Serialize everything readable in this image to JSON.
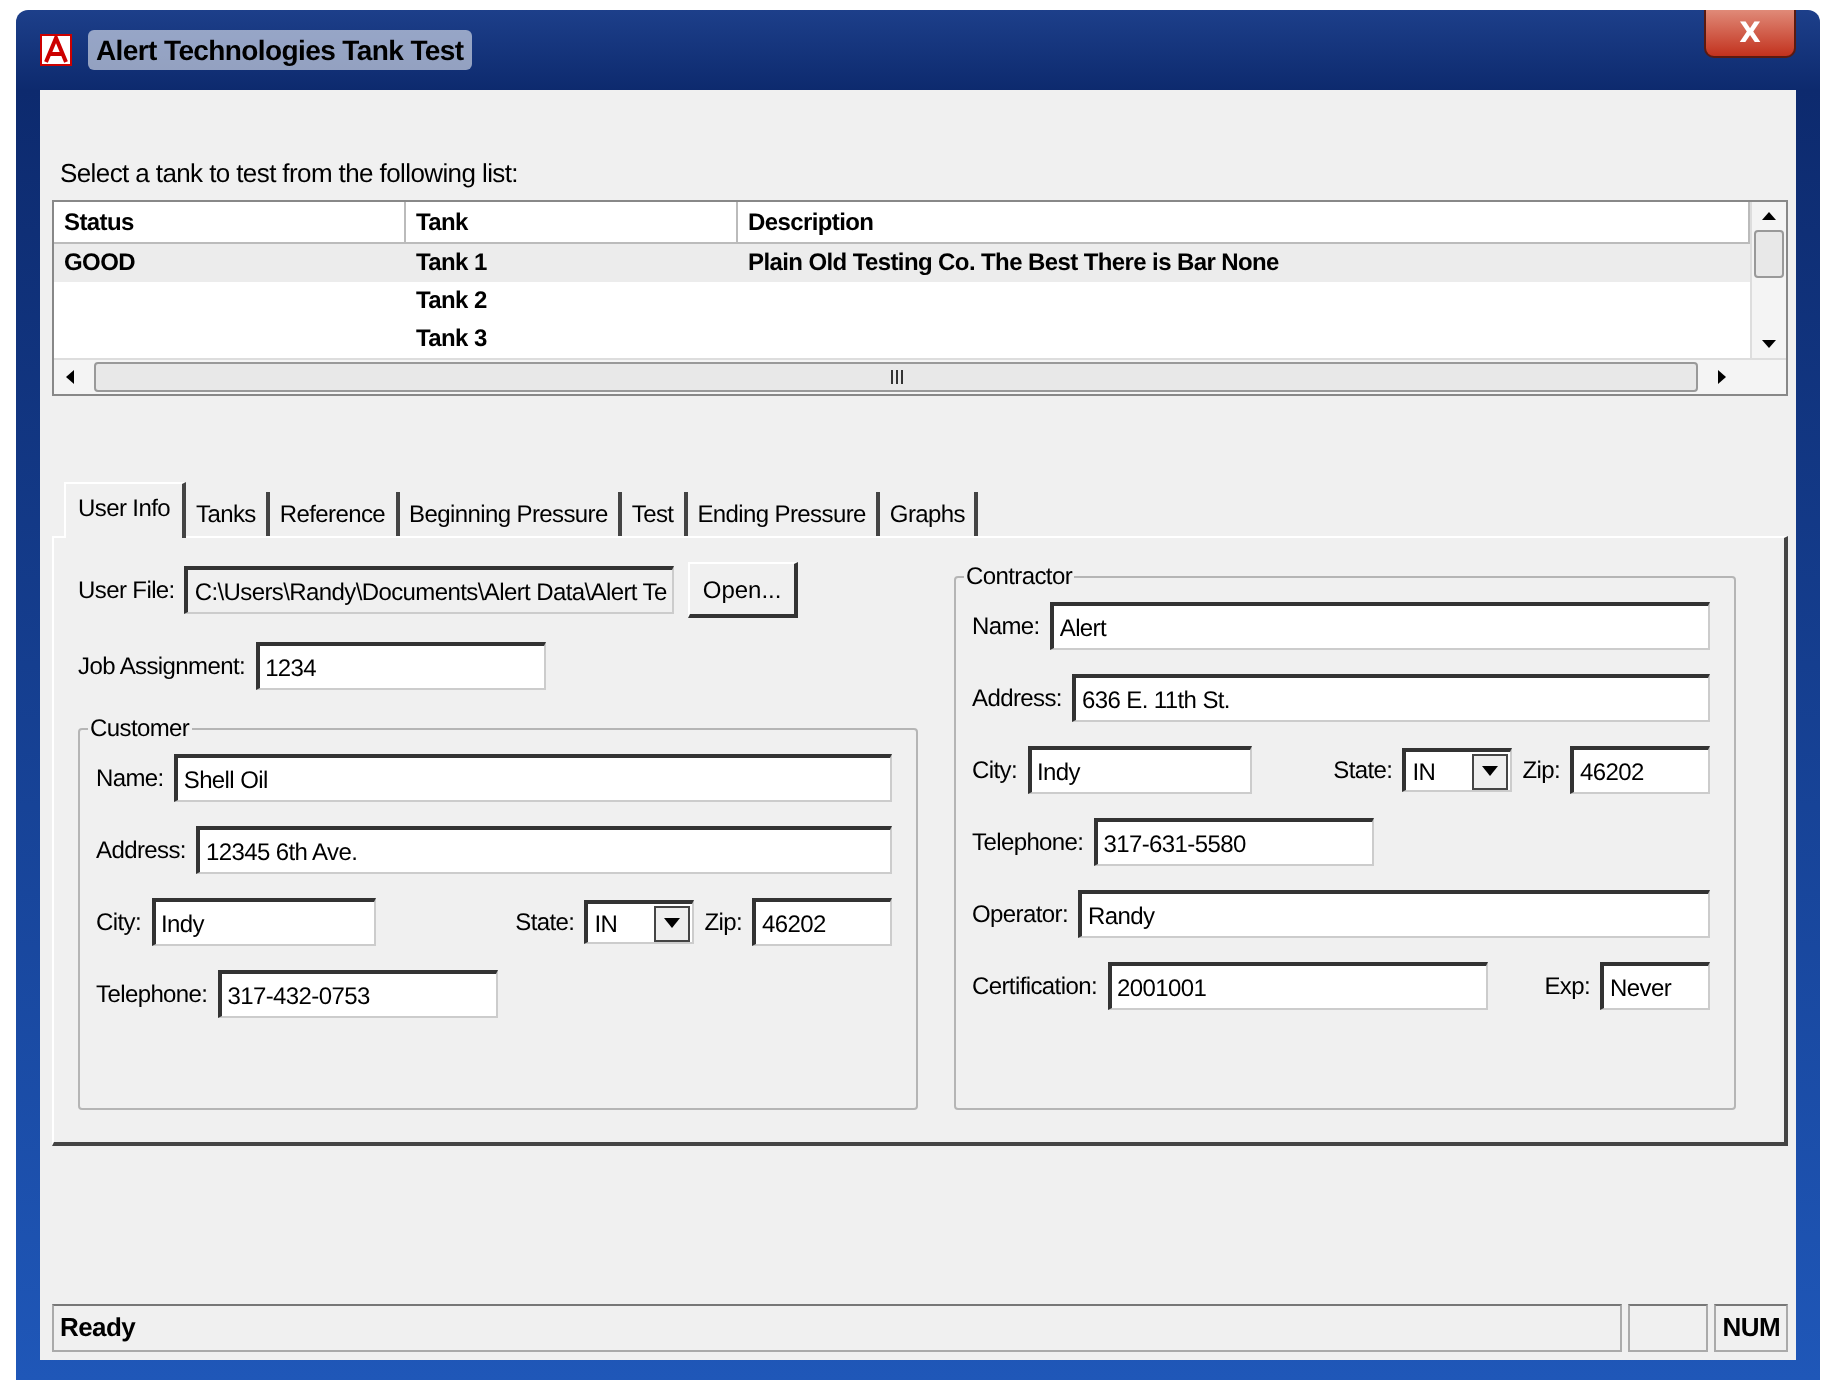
{
  "window": {
    "title": "Alert Technologies Tank Test",
    "close": "X"
  },
  "prompt": "Select a tank to test from the following list:",
  "tank_list": {
    "columns": [
      "Status",
      "Tank",
      "Description"
    ],
    "rows": [
      {
        "status": "GOOD",
        "tank": "Tank 1",
        "description": "Plain Old Testing Co. The Best There is Bar None",
        "selected": true
      },
      {
        "tank": "Tank 2",
        "selected": false
      },
      {
        "tank": "Tank 3",
        "selected": false
      }
    ]
  },
  "tabs": [
    {
      "label": "User Info",
      "selected": true
    },
    {
      "label": "Tanks",
      "selected": false
    },
    {
      "label": "Reference",
      "selected": false
    },
    {
      "label": "Beginning Pressure",
      "selected": false
    },
    {
      "label": "Test",
      "selected": false
    },
    {
      "label": "Ending Pressure",
      "selected": false
    },
    {
      "label": "Graphs",
      "selected": false
    }
  ],
  "user_file": {
    "label": "User File:",
    "value": "C:\\Users\\Randy\\Documents\\Alert Data\\Alert Te",
    "button": "Open..."
  },
  "job_assignment": {
    "label": "Job Assignment:",
    "value": "1234"
  },
  "customer": {
    "title": "Customer",
    "lines": [
      {
        "fields": [
          {
            "label": "Name:",
            "value": "Shell Oil",
            "kind": "text"
          }
        ]
      },
      {
        "fields": [
          {
            "label": "Address:",
            "value": "12345 6th Ave.",
            "kind": "text"
          }
        ]
      },
      {
        "fields": [
          {
            "label": "City:",
            "value": "Indy",
            "kind": "text"
          },
          {
            "label": "State:",
            "value": "IN",
            "kind": "dropdown"
          },
          {
            "label": "Zip:",
            "value": "46202",
            "kind": "text"
          }
        ]
      },
      {
        "fields": [
          {
            "label": "Telephone:",
            "value": "317-432-0753",
            "kind": "text"
          }
        ]
      }
    ]
  },
  "contractor": {
    "title": "Contractor",
    "lines": [
      {
        "fields": [
          {
            "label": "Name:",
            "value": "Alert",
            "kind": "text"
          }
        ]
      },
      {
        "fields": [
          {
            "label": "Address:",
            "value": "636 E. 11th St.",
            "kind": "text"
          }
        ]
      },
      {
        "fields": [
          {
            "label": "City:",
            "value": "Indy",
            "kind": "text"
          },
          {
            "label": "State:",
            "value": "IN",
            "kind": "dropdown"
          },
          {
            "label": "Zip:",
            "value": "46202",
            "kind": "text"
          }
        ]
      },
      {
        "fields": [
          {
            "label": "Telephone:",
            "value": "317-631-5580",
            "kind": "text"
          }
        ]
      },
      {
        "fields": [
          {
            "label": "Operator:",
            "value": "Randy",
            "kind": "text"
          }
        ]
      },
      {
        "fields": [
          {
            "label": "Certification:",
            "value": "2001001",
            "kind": "text"
          },
          {
            "label": "Exp:",
            "value": "Never",
            "kind": "text"
          }
        ]
      }
    ]
  },
  "status_bar": {
    "message": "Ready",
    "indicator": "NUM"
  }
}
